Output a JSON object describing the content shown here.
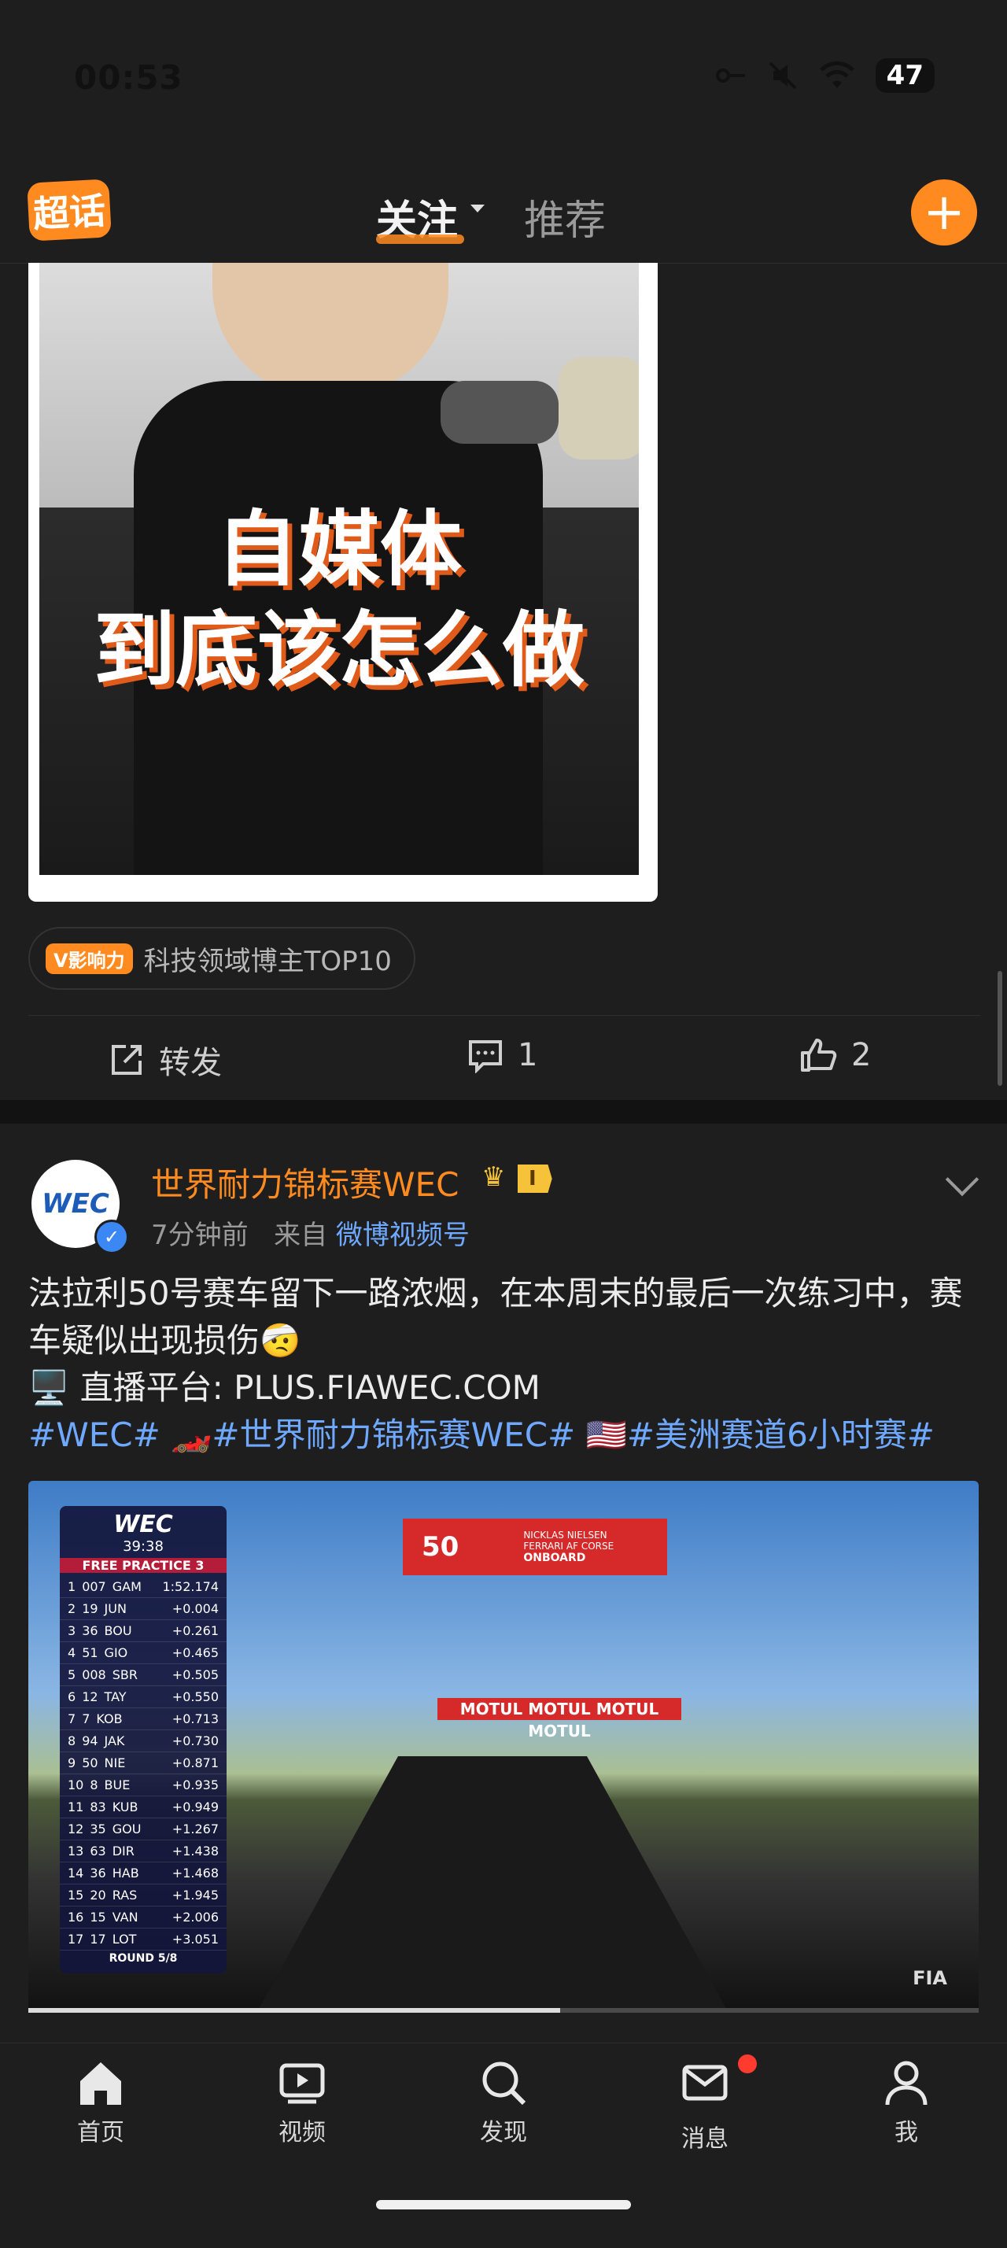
{
  "status_bar": {
    "time": "00:53",
    "battery": "47"
  },
  "header": {
    "logo_text": "超话",
    "tabs": [
      {
        "label": "关注",
        "active": true
      },
      {
        "label": "推荐",
        "active": false
      }
    ],
    "add_button": "+"
  },
  "post1": {
    "image_overlay_line1": "自媒体",
    "image_overlay_line2": "到底该怎么做",
    "influence_badge": "V影响力",
    "influence_text": "科技领域博主TOP10",
    "actions": {
      "repost": "转发",
      "comments": "1",
      "likes": "2"
    }
  },
  "post2": {
    "author": "世界耐力锦标赛WEC",
    "level": "I",
    "time": "7分钟前",
    "from_label": "来自",
    "source": "微博视频号",
    "text_line1": "法拉利50号赛车留下一路浓烟，在本周末的最后一次练习中，赛车疑似出现损伤🤕",
    "text_line2": "🖥️ 直播平台: PLUS.FIAWEC.COM",
    "hashtags": [
      "#WEC#",
      "🏎️#世界耐力锦标赛WEC#",
      "🇺🇸#美洲赛道6小时赛#"
    ],
    "video": {
      "session_logo": "WEC",
      "session_clock": "39:38",
      "session_name": "FREE PRACTICE 3",
      "round": "ROUND 5/8",
      "standings": [
        {
          "pos": "1",
          "num": "007",
          "code": "GAM",
          "gap": "1:52.174"
        },
        {
          "pos": "2",
          "num": "19",
          "code": "JUN",
          "gap": "+0.004"
        },
        {
          "pos": "3",
          "num": "36",
          "code": "BOU",
          "gap": "+0.261"
        },
        {
          "pos": "4",
          "num": "51",
          "code": "GIO",
          "gap": "+0.465"
        },
        {
          "pos": "5",
          "num": "008",
          "code": "SBR",
          "gap": "+0.505"
        },
        {
          "pos": "6",
          "num": "12",
          "code": "TAY",
          "gap": "+0.550"
        },
        {
          "pos": "7",
          "num": "7",
          "code": "KOB",
          "gap": "+0.713"
        },
        {
          "pos": "8",
          "num": "94",
          "code": "JAK",
          "gap": "+0.730"
        },
        {
          "pos": "9",
          "num": "50",
          "code": "NIE",
          "gap": "+0.871"
        },
        {
          "pos": "10",
          "num": "8",
          "code": "BUE",
          "gap": "+0.935"
        },
        {
          "pos": "11",
          "num": "83",
          "code": "KUB",
          "gap": "+0.949"
        },
        {
          "pos": "12",
          "num": "35",
          "code": "GOU",
          "gap": "+1.267"
        },
        {
          "pos": "13",
          "num": "63",
          "code": "DIR",
          "gap": "+1.438"
        },
        {
          "pos": "14",
          "num": "36",
          "code": "HAB",
          "gap": "+1.468"
        },
        {
          "pos": "15",
          "num": "20",
          "code": "RAS",
          "gap": "+1.945"
        },
        {
          "pos": "16",
          "num": "15",
          "code": "VAN",
          "gap": "+2.006"
        },
        {
          "pos": "17",
          "num": "17",
          "code": "LOT",
          "gap": "+3.051"
        }
      ],
      "car_number": "50",
      "driver": "NICKLAS NIELSEN",
      "team": "FERRARI AF CORSE",
      "onboard": "ONBOARD",
      "banner": "MOTUL MOTUL MOTUL MOTUL",
      "fia_mark": "FIA",
      "progress": 0.56
    }
  },
  "bottom_nav": [
    {
      "label": "首页",
      "icon": "home-icon"
    },
    {
      "label": "视频",
      "icon": "video-icon"
    },
    {
      "label": "发现",
      "icon": "search-icon"
    },
    {
      "label": "消息",
      "icon": "mail-icon",
      "badge": true
    },
    {
      "label": "我",
      "icon": "profile-icon"
    }
  ],
  "colors": {
    "accent": "#ff8a1f",
    "link": "#6fa8ff",
    "background": "#1e1e1e"
  }
}
